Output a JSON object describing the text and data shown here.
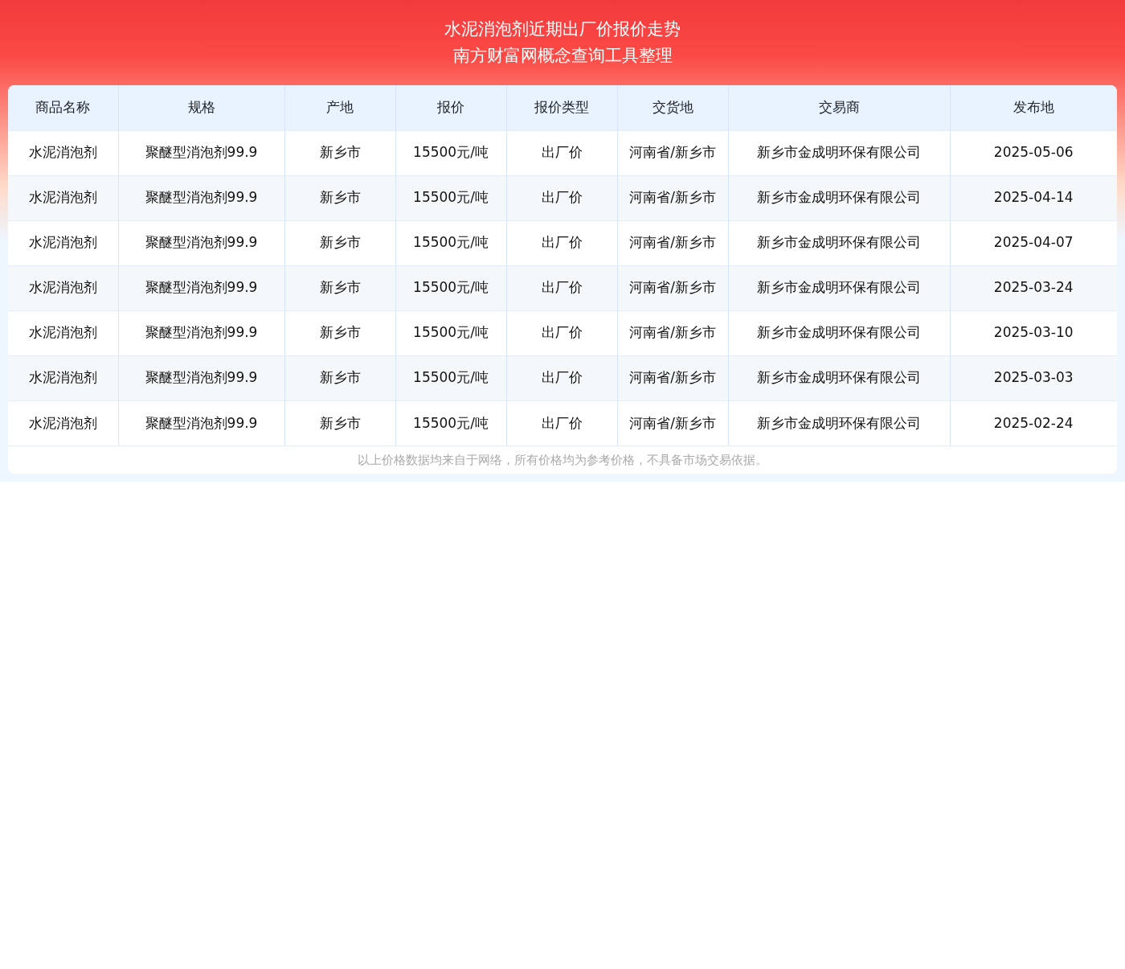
{
  "header": {
    "title": "水泥消泡剂近期出厂价报价走势",
    "subtitle": "南方财富网概念查询工具整理"
  },
  "table": {
    "columns": [
      "商品名称",
      "规格",
      "产地",
      "报价",
      "报价类型",
      "交货地",
      "交易商",
      "发布地"
    ],
    "rows": [
      [
        "水泥消泡剂",
        "聚醚型消泡剂99.9",
        "新乡市",
        "15500元/吨",
        "出厂价",
        "河南省/新乡市",
        "新乡市金成明环保有限公司",
        "2025-05-06"
      ],
      [
        "水泥消泡剂",
        "聚醚型消泡剂99.9",
        "新乡市",
        "15500元/吨",
        "出厂价",
        "河南省/新乡市",
        "新乡市金成明环保有限公司",
        "2025-04-14"
      ],
      [
        "水泥消泡剂",
        "聚醚型消泡剂99.9",
        "新乡市",
        "15500元/吨",
        "出厂价",
        "河南省/新乡市",
        "新乡市金成明环保有限公司",
        "2025-04-07"
      ],
      [
        "水泥消泡剂",
        "聚醚型消泡剂99.9",
        "新乡市",
        "15500元/吨",
        "出厂价",
        "河南省/新乡市",
        "新乡市金成明环保有限公司",
        "2025-03-24"
      ],
      [
        "水泥消泡剂",
        "聚醚型消泡剂99.9",
        "新乡市",
        "15500元/吨",
        "出厂价",
        "河南省/新乡市",
        "新乡市金成明环保有限公司",
        "2025-03-10"
      ],
      [
        "水泥消泡剂",
        "聚醚型消泡剂99.9",
        "新乡市",
        "15500元/吨",
        "出厂价",
        "河南省/新乡市",
        "新乡市金成明环保有限公司",
        "2025-03-03"
      ],
      [
        "水泥消泡剂",
        "聚醚型消泡剂99.9",
        "新乡市",
        "15500元/吨",
        "出厂价",
        "河南省/新乡市",
        "新乡市金成明环保有限公司",
        "2025-02-24"
      ]
    ]
  },
  "footnote": "以上价格数据均来自于网络，所有价格均为参考价格，不具备市场交易依据。"
}
